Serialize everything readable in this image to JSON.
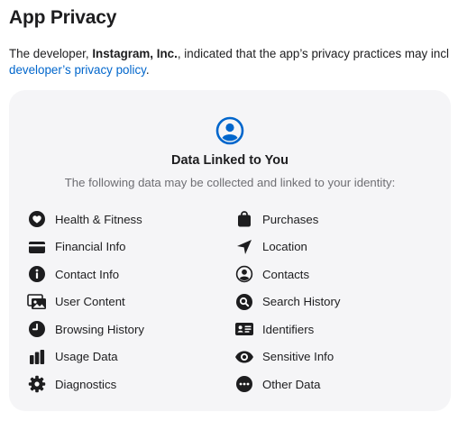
{
  "section": {
    "title": "App Privacy"
  },
  "intro": {
    "prefix": "The developer, ",
    "developer": "Instagram, Inc.",
    "suffix": ", indicated that the app’s privacy practices may incl",
    "link_label": "developer’s privacy policy",
    "trailing": "."
  },
  "card": {
    "icon": "person-circle-icon",
    "title": "Data Linked to You",
    "description": "The following data may be collected and linked to your identity:"
  },
  "categories": {
    "left": [
      {
        "icon": "heart-icon",
        "label": "Health & Fitness"
      },
      {
        "icon": "credit-card-icon",
        "label": "Financial Info"
      },
      {
        "icon": "info-icon",
        "label": "Contact Info"
      },
      {
        "icon": "photos-icon",
        "label": "User Content"
      },
      {
        "icon": "clock-icon",
        "label": "Browsing History"
      },
      {
        "icon": "bar-chart-icon",
        "label": "Usage Data"
      },
      {
        "icon": "gear-icon",
        "label": "Diagnostics"
      }
    ],
    "right": [
      {
        "icon": "shopping-bag-icon",
        "label": "Purchases"
      },
      {
        "icon": "location-arrow-icon",
        "label": "Location"
      },
      {
        "icon": "person-circle-icon",
        "label": "Contacts"
      },
      {
        "icon": "magnifying-glass-icon",
        "label": "Search History"
      },
      {
        "icon": "id-card-icon",
        "label": "Identifiers"
      },
      {
        "icon": "eye-icon",
        "label": "Sensitive Info"
      },
      {
        "icon": "ellipsis-circle-icon",
        "label": "Other Data"
      }
    ]
  },
  "colors": {
    "accent": "#0066cc",
    "icon": "#1d1d1f",
    "card_background": "#f5f5f7",
    "secondary_text": "#6e6e73"
  }
}
